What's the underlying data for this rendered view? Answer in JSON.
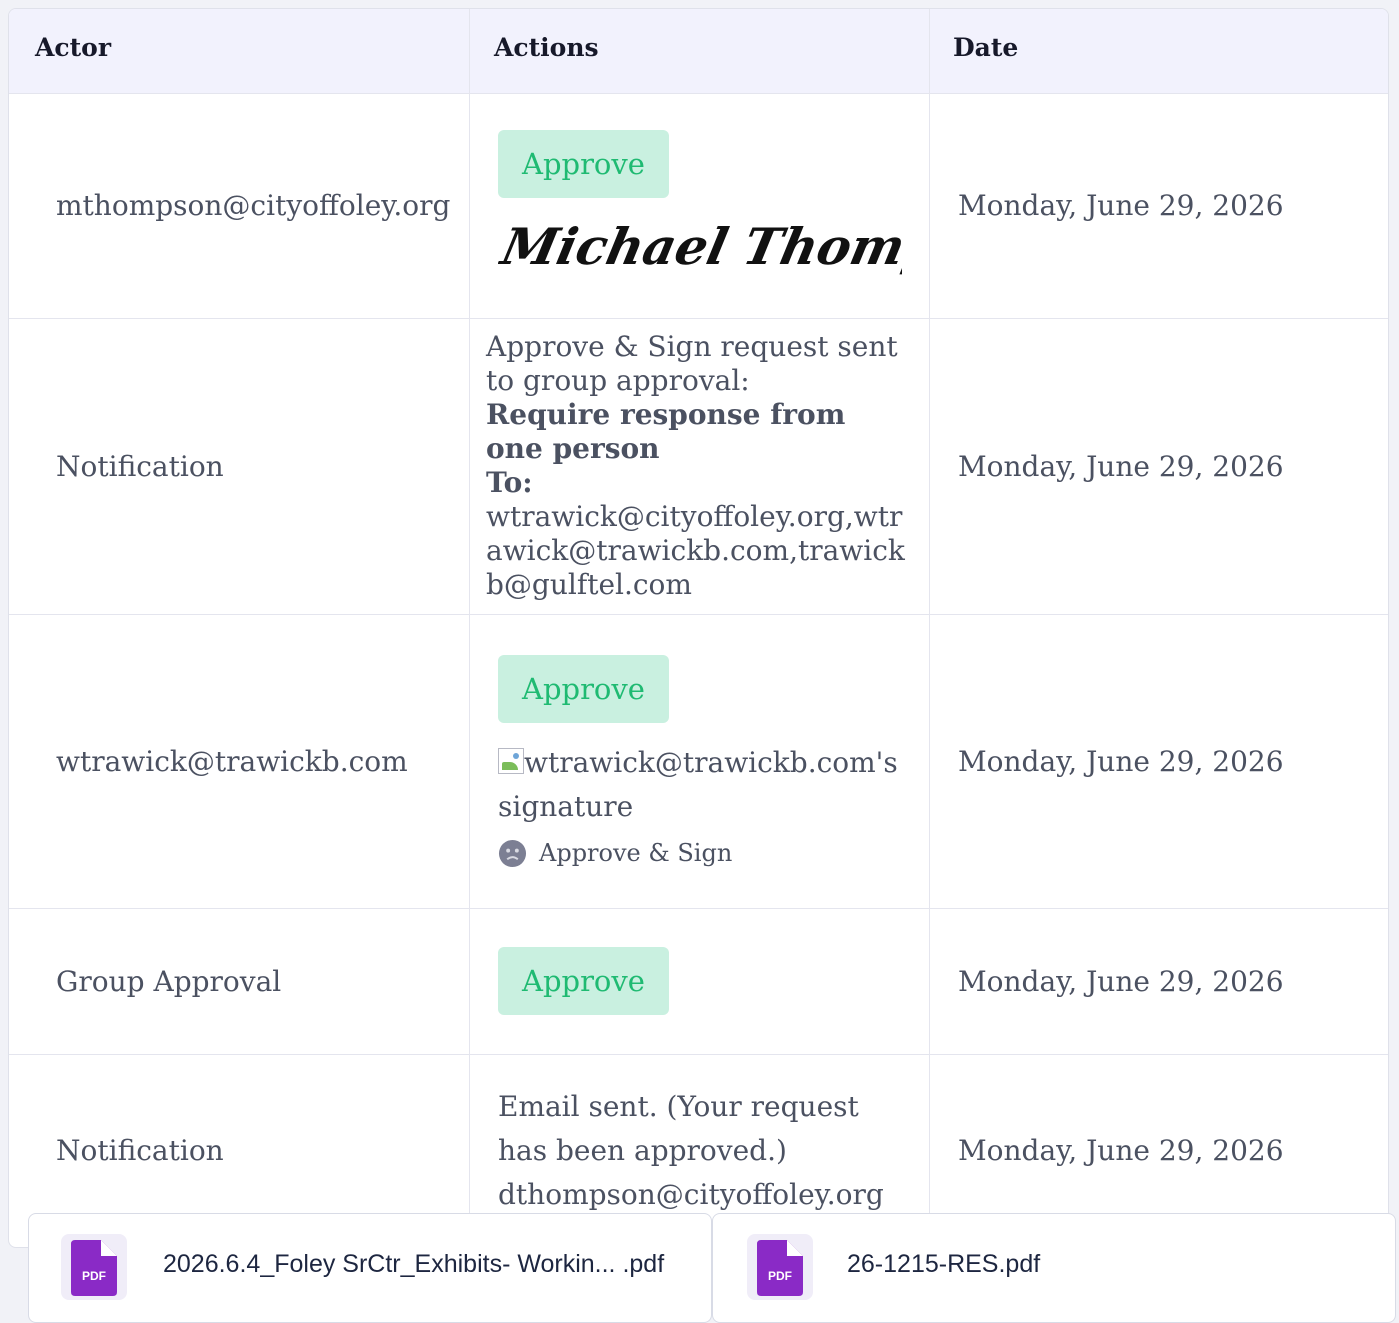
{
  "table": {
    "headers": {
      "actor": "Actor",
      "actions": "Actions",
      "date": "Date"
    },
    "rows": [
      {
        "actor": "mthompson@cityoffoley.org",
        "action_button": "Approve",
        "signature": "Michael Thompson",
        "date": "Monday, June 29, 2026"
      },
      {
        "actor": "Notification",
        "text_intro": "Approve & Sign request sent to group approval:",
        "text_bold": "Require response from one person",
        "to_label": "To:",
        "to_value": "wtrawick@cityoffoley.org,wtrawick@trawickb.com,trawickb@gulftel.com",
        "date": "Monday, June 29, 2026"
      },
      {
        "actor": "wtrawick@trawickb.com",
        "action_button": "Approve",
        "signature_alt": "wtrawick@trawickb.com's signature",
        "sub_action": "Approve & Sign",
        "date": "Monday, June 29, 2026"
      },
      {
        "actor": "Group Approval",
        "action_button": "Approve",
        "date": "Monday, June 29, 2026"
      },
      {
        "actor": "Notification",
        "email_line1": "Email sent. (Your request has been approved.)",
        "email_line2": "dthompson@cityoffoley.org",
        "date": "Monday, June 29, 2026"
      }
    ]
  },
  "attachments": [
    {
      "badge": "PDF",
      "name": "2026.6.4_Foley SrCtr_Exhibits- Workin... .pdf"
    },
    {
      "badge": "PDF",
      "name": "26-1215-RES.pdf"
    }
  ],
  "colors": {
    "approve_bg": "#c9f0e0",
    "approve_text": "#1fba72",
    "header_bg": "#f2f2fd",
    "pdf_purple": "#8a2ac6"
  }
}
